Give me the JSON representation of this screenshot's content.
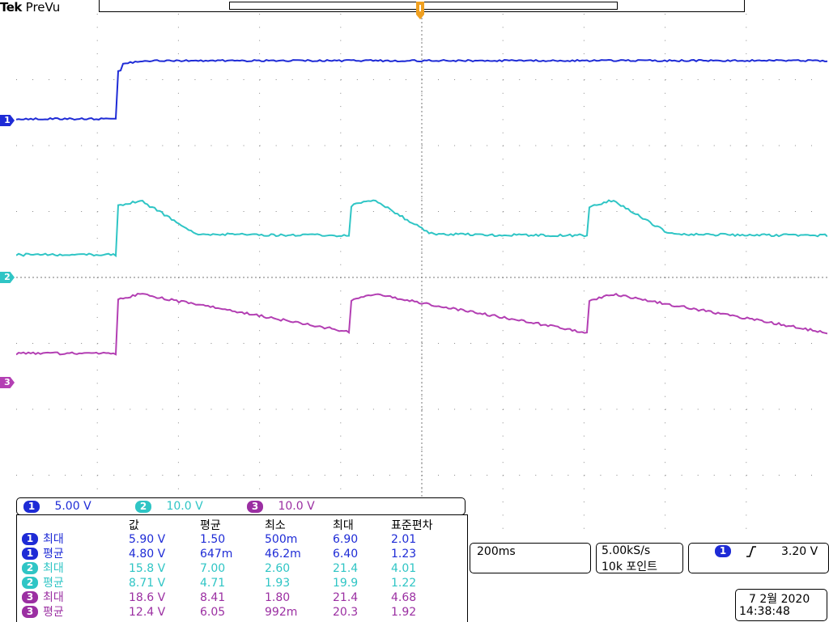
{
  "header": {
    "brand": "Tek",
    "mode": "PreVu"
  },
  "channels": [
    {
      "id": "1",
      "color": "#1e2bd6"
    },
    {
      "id": "2",
      "color": "#2fc5c5"
    },
    {
      "id": "3",
      "color": "#9b2fa2"
    }
  ],
  "scales": [
    {
      "ch": "1",
      "value": "5.00 V"
    },
    {
      "ch": "2",
      "value": "10.0 V"
    },
    {
      "ch": "3",
      "value": "10.0 V"
    }
  ],
  "measurements": {
    "headers": [
      "값",
      "평균",
      "최소",
      "최대",
      "표준편차"
    ],
    "rows": [
      {
        "ch": "1",
        "label": "최대",
        "value": "5.90 V",
        "mean": "1.50",
        "min": "500m",
        "max": "6.90",
        "std": "2.01"
      },
      {
        "ch": "1",
        "label": "평균",
        "value": "4.80 V",
        "mean": "647m",
        "min": "46.2m",
        "max": "6.40",
        "std": "1.23"
      },
      {
        "ch": "2",
        "label": "최대",
        "value": "15.8 V",
        "mean": "7.00",
        "min": "2.60",
        "max": "21.4",
        "std": "4.01"
      },
      {
        "ch": "2",
        "label": "평균",
        "value": "8.71 V",
        "mean": "4.71",
        "min": "1.93",
        "max": "19.9",
        "std": "1.22"
      },
      {
        "ch": "3",
        "label": "최대",
        "value": "18.6 V",
        "mean": "8.41",
        "min": "1.80",
        "max": "21.4",
        "std": "4.68"
      },
      {
        "ch": "3",
        "label": "평균",
        "value": "12.4 V",
        "mean": "6.05",
        "min": "992m",
        "max": "20.3",
        "std": "1.92"
      }
    ]
  },
  "timebase": "200ms",
  "acquisition": {
    "sample_rate": "5.00kS/s",
    "record_length": "10k 포인트"
  },
  "trigger": {
    "source": "1",
    "slope_icon": "rising-edge-icon",
    "level": "3.20 V"
  },
  "datetime": {
    "date": "7 2월  2020",
    "time": "14:38:48"
  }
}
